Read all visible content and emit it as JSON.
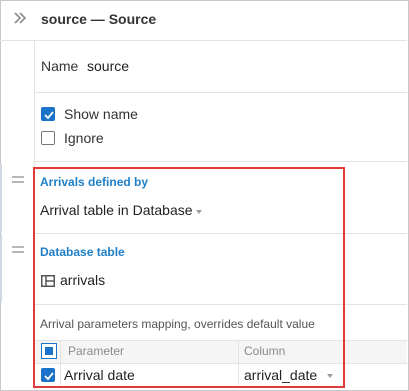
{
  "header": {
    "title": "source — Source",
    "collapse_icon": "double-chevron-right-icon"
  },
  "name_row": {
    "label": "Name",
    "value": "source"
  },
  "options": {
    "show_name": {
      "label": "Show name",
      "checked": true
    },
    "ignore": {
      "label": "Ignore",
      "checked": false
    }
  },
  "arrivals": {
    "section_title": "Arrivals defined by",
    "selected": "Arrival table in Database"
  },
  "database_table": {
    "section_title": "Database table",
    "value": "arrivals",
    "icon": "table-icon"
  },
  "mapping": {
    "description": "Arrival parameters mapping, overrides default value",
    "columns": [
      "Parameter",
      "Column"
    ],
    "rows": [
      {
        "checked": true,
        "parameter": "Arrival date",
        "column": "arrival_date"
      }
    ]
  },
  "colors": {
    "accent": "#1a73c8",
    "section": "#1e7fc6",
    "highlight": "#e03a3a"
  }
}
